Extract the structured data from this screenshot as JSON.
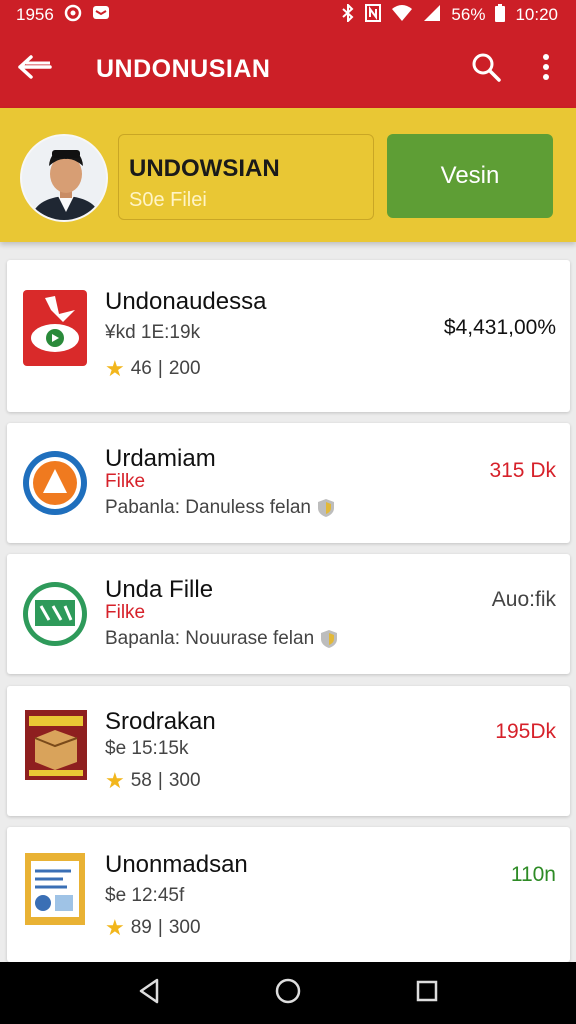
{
  "status_bar": {
    "time_left": "1956",
    "battery": "56%",
    "clock": "10:20"
  },
  "app_bar": {
    "title": "UNDONUSIAN",
    "back_icon": "back-arrow-icon",
    "search_icon": "search-icon",
    "menu_icon": "more-vert-icon",
    "color": "#cc1f27"
  },
  "profile": {
    "name": "UNDOWSIAN",
    "subtitle": "S0e Filei",
    "button_label": "Vesin",
    "banner_color": "#e9c734",
    "button_color": "#5e9e35"
  },
  "items": [
    {
      "name": "Undonaudessa",
      "line2": "¥kd 1E:19k",
      "rating": "46",
      "reviews": "200",
      "price": "$4,431,00%",
      "price_color": "#111111"
    },
    {
      "name": "Urdamiam",
      "line2": "Filke",
      "line3": "Pabanla: Danuless felan",
      "price": "315 Dk",
      "price_color": "#d6212a"
    },
    {
      "name": "Unda Fille",
      "line2": "Filke",
      "line3": "Bapanla: Nouurase felan",
      "price": "Auo:fik",
      "price_color": "#444444"
    },
    {
      "name": "Srodrakan",
      "line2": "$e 15:15k",
      "rating": "58",
      "reviews": "300",
      "price": "195Dk",
      "price_color": "#d6212a"
    },
    {
      "name": "Unonmadsan",
      "line2": "$e 12:45f",
      "rating": "89",
      "reviews": "300",
      "price": "110n",
      "price_color": "#2e8b26"
    }
  ],
  "nav": {
    "back": "nav-back-icon",
    "home": "nav-home-icon",
    "recents": "nav-recents-icon"
  }
}
